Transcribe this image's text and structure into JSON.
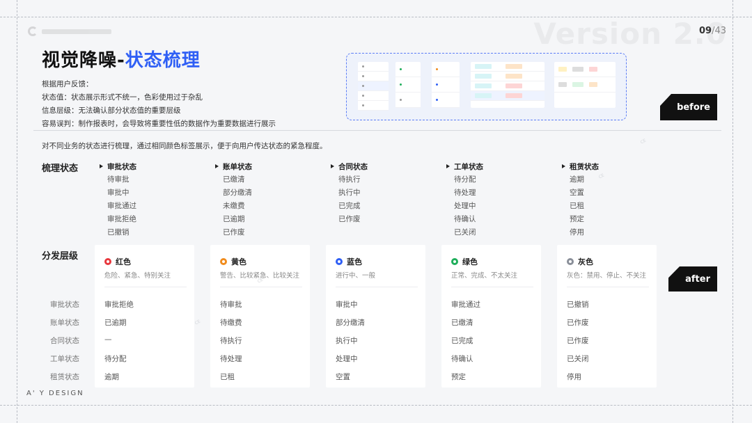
{
  "page": {
    "current": "09",
    "total": "/43",
    "version": "Version 2.0"
  },
  "title": {
    "main": "视觉降噪-",
    "accent": "状态梳理"
  },
  "intro": [
    "根据用户反馈：",
    "状态值：状态展示形式不统一，色彩使用过于杂乱",
    "信息层级：无法确认部分状态值的重要层级",
    "容易误判：制作报表时，会导致将重要性低的数据作为重要数据进行展示"
  ],
  "labels": {
    "before": "before",
    "after": "after"
  },
  "description": "对不同业务的状态进行梳理，通过相同颜色标签展示，便于向用户传达状态的紧急程度。",
  "sections": {
    "organize": "梳理状态",
    "levels": "分发层级"
  },
  "categories": [
    {
      "name": "审批状态",
      "items": [
        "待审批",
        "审批中",
        "审批通过",
        "审批拒绝",
        "已撤销"
      ]
    },
    {
      "name": "账单状态",
      "items": [
        "已缴清",
        "部分缴清",
        "未缴费",
        "已逾期",
        "已作废"
      ]
    },
    {
      "name": "合同状态",
      "items": [
        "待执行",
        "执行中",
        "已完成",
        "已作废"
      ]
    },
    {
      "name": "工单状态",
      "items": [
        "待分配",
        "待处理",
        "处理中",
        "待确认",
        "已关闭"
      ]
    },
    {
      "name": "租赁状态",
      "items": [
        "逾期",
        "空置",
        "已租",
        "预定",
        "停用"
      ]
    }
  ],
  "row_labels": [
    "审批状态",
    "账单状态",
    "合同状态",
    "工单状态",
    "租赁状态"
  ],
  "colors": [
    {
      "name": "红色",
      "color": "#e8383d",
      "desc": "危险、紧急、特别关注",
      "items": [
        "审批拒绝",
        "已逾期",
        "—",
        "待分配",
        "逾期"
      ]
    },
    {
      "name": "黄色",
      "color": "#f08c1e",
      "desc": "警告、比较紧急、比较关注",
      "items": [
        "待审批",
        "待缴费",
        "待执行",
        "待处理",
        "已租"
      ]
    },
    {
      "name": "蓝色",
      "color": "#2f5ff5",
      "desc": "进行中、一般",
      "items": [
        "审批中",
        "部分缴清",
        "执行中",
        "处理中",
        "空置"
      ]
    },
    {
      "name": "绿色",
      "color": "#1fae5b",
      "desc": "正常、完成、不太关注",
      "items": [
        "审批通过",
        "已缴清",
        "已完成",
        "待确认",
        "预定"
      ]
    },
    {
      "name": "灰色",
      "color": "#8a8f99",
      "desc": "灰色：禁用、停止、不关注",
      "items": [
        "已撤销",
        "已作废",
        "已作废",
        "已关闭",
        "停用"
      ]
    }
  ],
  "footer": "A' Y DESIGN"
}
